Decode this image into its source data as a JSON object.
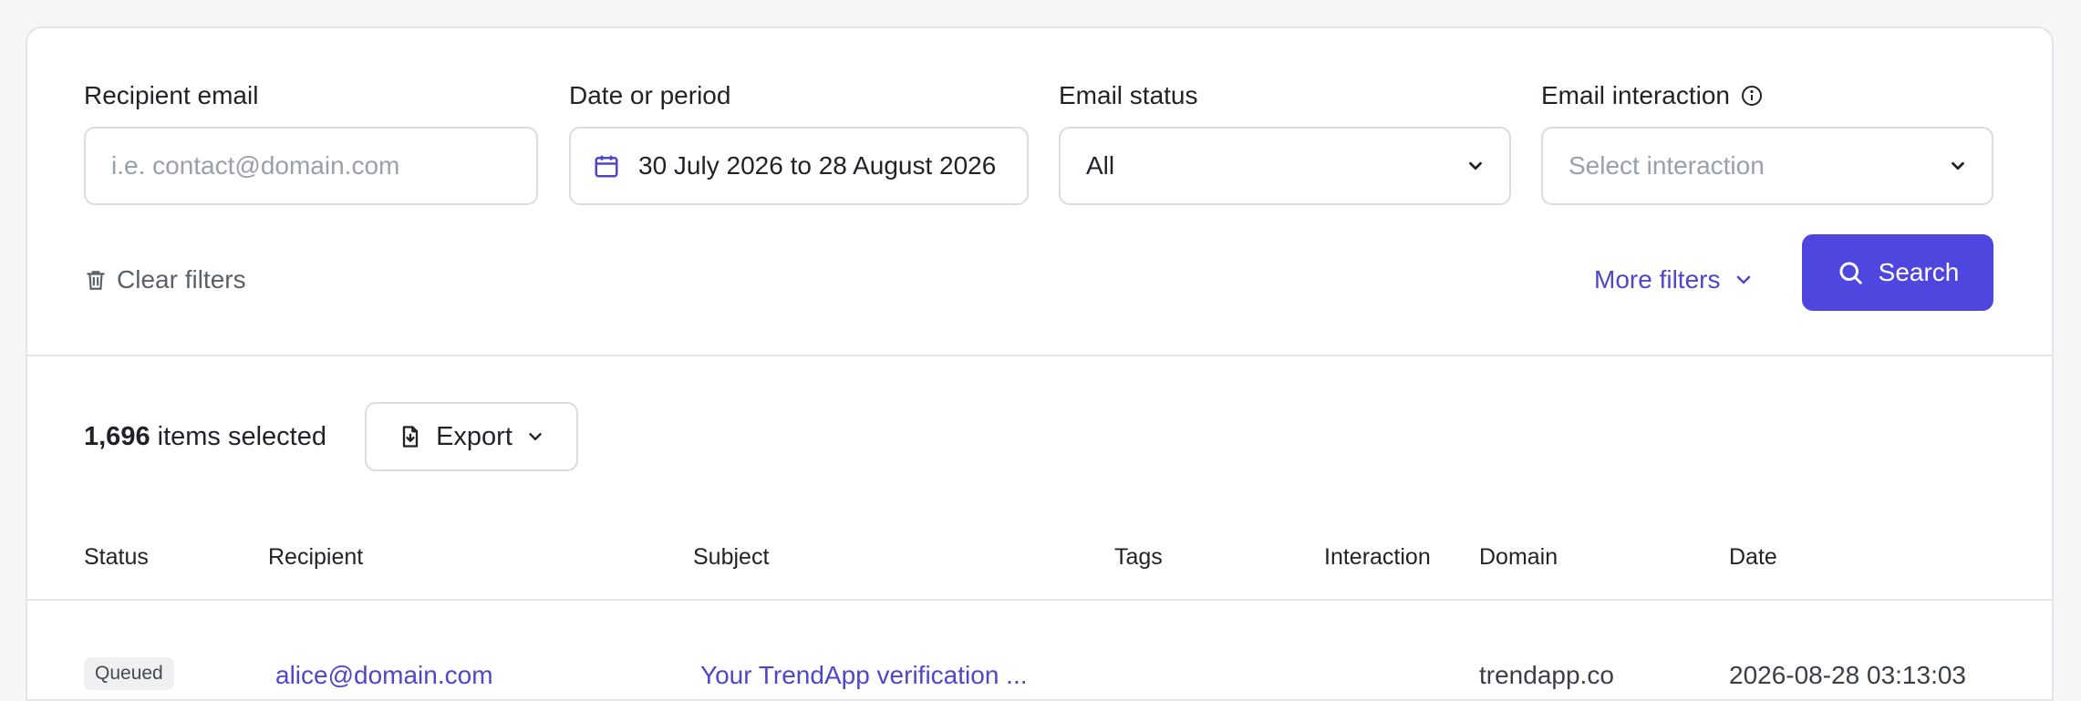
{
  "filters": {
    "recipient_email": {
      "label": "Recipient email",
      "placeholder": "i.e. contact@domain.com"
    },
    "date_period": {
      "label": "Date or period",
      "value": "30 July 2026 to 28 August 2026"
    },
    "email_status": {
      "label": "Email status",
      "value": "All"
    },
    "email_interaction": {
      "label": "Email interaction",
      "placeholder": "Select interaction"
    },
    "clear_filters": "Clear filters",
    "more_filters": "More filters",
    "search": "Search"
  },
  "results": {
    "count": "1,696",
    "count_suffix": " items selected",
    "export": "Export"
  },
  "table": {
    "columns": [
      "Status",
      "Recipient",
      "Subject",
      "Tags",
      "Interaction",
      "Domain",
      "Date"
    ],
    "rows": [
      {
        "status": "Queued",
        "recipient": "alice@domain.com",
        "subject": "Your TrendApp verification ...",
        "tags": "",
        "interaction": "",
        "domain": "trendapp.co",
        "date": "2026-08-28 03:13:03"
      }
    ]
  },
  "colors": {
    "accent": "#4f46e0",
    "link": "#4f46c8",
    "border": "#d9dce1",
    "background": "#f5f6f8"
  },
  "icons": [
    "calendar-icon",
    "chevron-down-icon",
    "info-icon",
    "trash-icon",
    "search-icon",
    "file-export-icon"
  ]
}
